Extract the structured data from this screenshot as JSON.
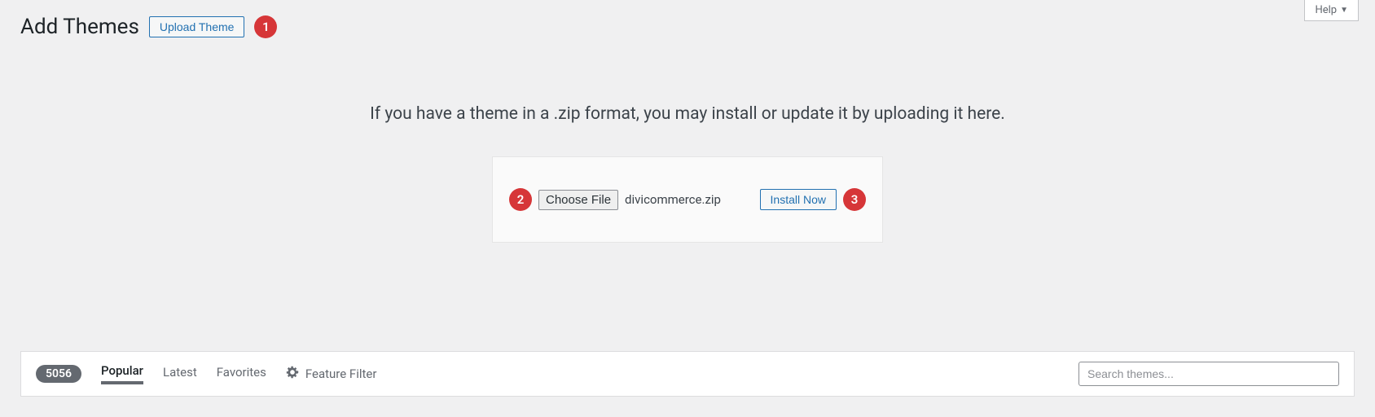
{
  "help": {
    "label": "Help"
  },
  "header": {
    "title": "Add Themes",
    "upload_button": "Upload Theme"
  },
  "annotations": {
    "step1": "1",
    "step2": "2",
    "step3": "3"
  },
  "upload": {
    "info_text": "If you have a theme in a .zip format, you may install or update it by uploading it here.",
    "choose_file_label": "Choose File",
    "filename": "divicommerce.zip",
    "install_button": "Install Now"
  },
  "filter": {
    "count": "5056",
    "tabs": {
      "popular": "Popular",
      "latest": "Latest",
      "favorites": "Favorites",
      "feature_filter": "Feature Filter"
    },
    "search_placeholder": "Search themes..."
  }
}
